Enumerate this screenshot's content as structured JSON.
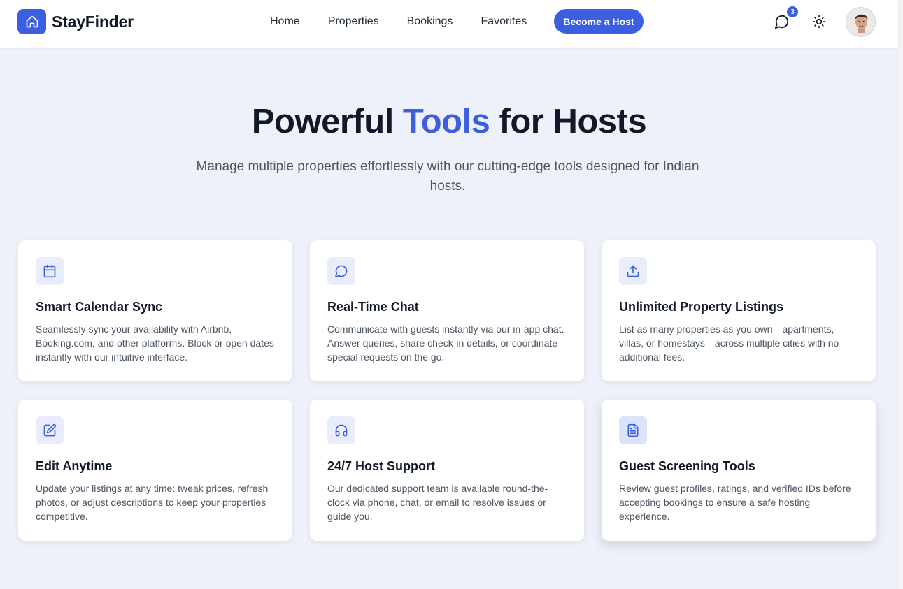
{
  "brand": {
    "name": "StayFinder",
    "logo_icon": "home-icon"
  },
  "nav": {
    "items": [
      {
        "label": "Home"
      },
      {
        "label": "Properties"
      },
      {
        "label": "Bookings"
      },
      {
        "label": "Favorites"
      }
    ],
    "cta_label": "Become a Host"
  },
  "header_actions": {
    "chat_icon": "message-circle-icon",
    "chat_badge": "3",
    "theme_icon": "sun-icon",
    "avatar_icon": "user-avatar"
  },
  "hero": {
    "title_before": "Powerful ",
    "title_accent": "Tools",
    "title_after": " for Hosts",
    "subtitle": "Manage multiple properties effortlessly with our cutting-edge tools designed for Indian hosts."
  },
  "features": [
    {
      "icon": "calendar-icon",
      "title": "Smart Calendar Sync",
      "description": "Seamlessly sync your availability with Airbnb, Booking.com, and other platforms. Block or open dates instantly with our intuitive interface."
    },
    {
      "icon": "chat-icon",
      "title": "Real-Time Chat",
      "description": "Communicate with guests instantly via our in-app chat. Answer queries, share check-in details, or coordinate special requests on the go."
    },
    {
      "icon": "upload-icon",
      "title": "Unlimited Property Listings",
      "description": "List as many properties as you own—apartments, villas, or homestays—across multiple cities with no additional fees."
    },
    {
      "icon": "edit-icon",
      "title": "Edit Anytime",
      "description": "Update your listings at any time: tweak prices, refresh photos, or adjust descriptions to keep your properties competitive."
    },
    {
      "icon": "headphones-icon",
      "title": "24/7 Host Support",
      "description": "Our dedicated support team is available round-the-clock via phone, chat, or email to resolve issues or guide you."
    },
    {
      "icon": "document-icon",
      "title": "Guest Screening Tools",
      "description": "Review guest profiles, ratings, and verified IDs before accepting bookings to ensure a safe hosting experience."
    }
  ],
  "colors": {
    "accent": "#3b5fe0",
    "background": "#eef0fa",
    "card": "#ffffff",
    "text": "#111827",
    "muted": "#4b5563"
  }
}
